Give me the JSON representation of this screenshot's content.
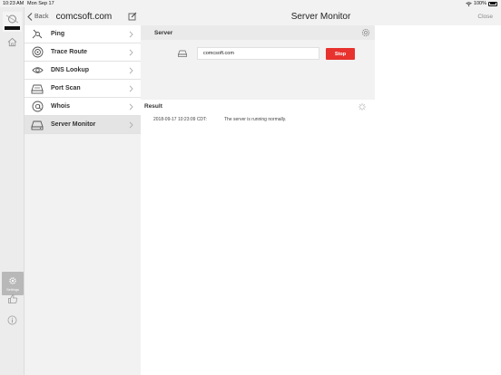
{
  "status_bar": {
    "time": "10:23 AM",
    "date": "Mon Sep 17",
    "battery": "100%"
  },
  "rail": {
    "settings_label": "Settings"
  },
  "nav": {
    "back_label": "Back",
    "title": "comcsoft.com"
  },
  "tools": [
    {
      "label": "Ping",
      "icon": "ping-icon"
    },
    {
      "label": "Trace Route",
      "icon": "trace-route-icon"
    },
    {
      "label": "DNS Lookup",
      "icon": "dns-lookup-icon"
    },
    {
      "label": "Port Scan",
      "icon": "port-scan-icon"
    },
    {
      "label": "Whois",
      "icon": "whois-icon"
    },
    {
      "label": "Server Monitor",
      "icon": "server-monitor-icon",
      "active": true
    }
  ],
  "main": {
    "title": "Server Monitor",
    "close_label": "Close",
    "server_section": {
      "title": "Server",
      "host_value": "comcsoft.com",
      "stop_label": "Stop"
    },
    "result_section": {
      "title": "Result",
      "log": [
        {
          "time": "2018-09-17 10:23:09 CDT:",
          "message": "The server is running normally."
        }
      ]
    }
  },
  "colors": {
    "accent_red": "#e8322e",
    "background": "#f2f2f2",
    "active_row": "#e4e4e4"
  }
}
